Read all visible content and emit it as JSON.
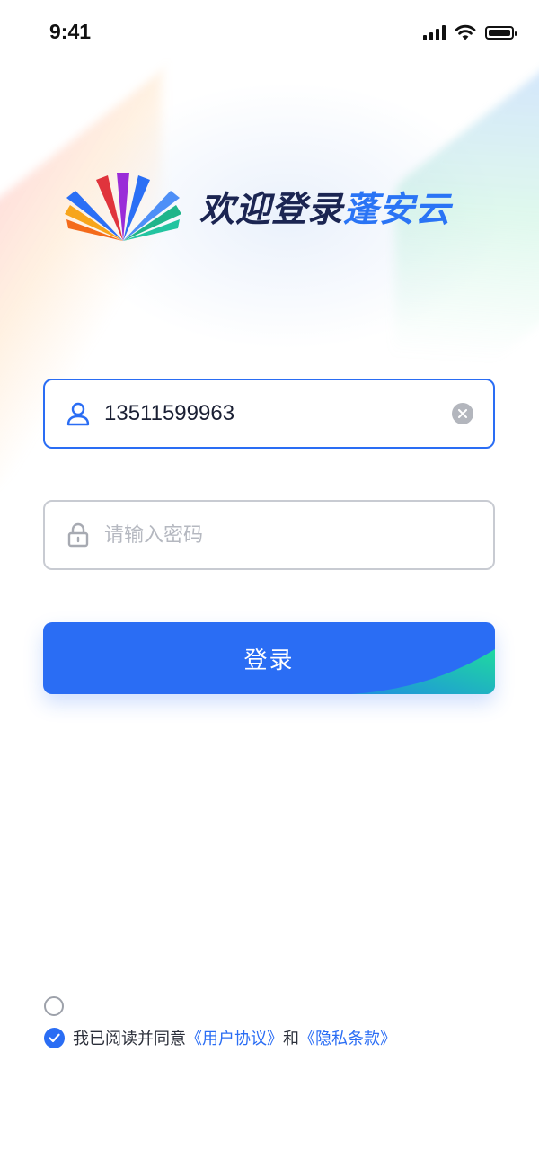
{
  "status_bar": {
    "time": "9:41",
    "icons": [
      "signal-icon",
      "wifi-icon",
      "battery-icon"
    ]
  },
  "header": {
    "welcome_prefix": "欢迎登录",
    "brand_name": "蓬安云",
    "logo": "fan-logo"
  },
  "form": {
    "phone": {
      "value": "13511599963",
      "icon": "user-icon",
      "clear_icon": "clear-icon"
    },
    "password": {
      "placeholder": "请输入密码",
      "value": "",
      "icon": "lock-icon"
    },
    "login_label": "登录"
  },
  "agreement": {
    "checked": true,
    "prefix": "我已阅读并同意",
    "user_agreement": "《用户协议》",
    "and": "和",
    "privacy_policy": "《隐私条款》"
  },
  "colors": {
    "primary": "#2a6df4",
    "title": "#1b2552",
    "accent_green": "#1fd5a4"
  }
}
